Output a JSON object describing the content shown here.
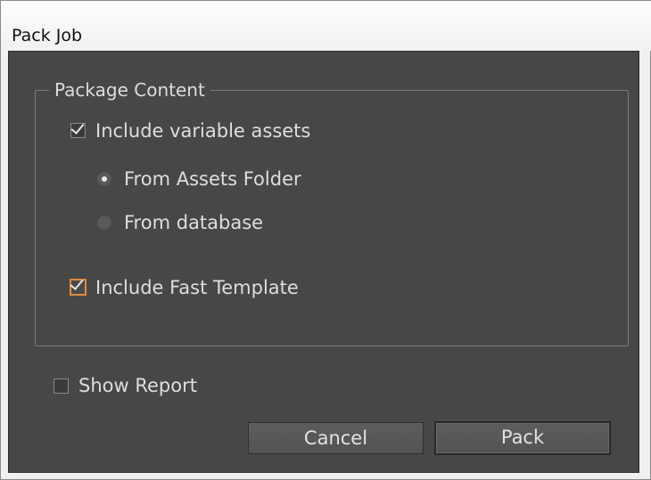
{
  "window": {
    "title": "Pack Job"
  },
  "group": {
    "label": "Package Content"
  },
  "options": {
    "include_variable_assets": {
      "label": "Include variable assets",
      "checked": true
    },
    "from_assets_folder": {
      "label": "From Assets Folder",
      "selected": true
    },
    "from_database": {
      "label": "From database",
      "selected": false
    },
    "include_fast_template": {
      "label": "Include Fast Template",
      "checked": true,
      "focused": true
    },
    "show_report": {
      "label": "Show Report",
      "checked": false
    }
  },
  "buttons": {
    "cancel": "Cancel",
    "pack": "Pack"
  },
  "colors": {
    "panel_bg": "#474747",
    "focus_accent": "#e08a3c",
    "text": "#dedede"
  }
}
